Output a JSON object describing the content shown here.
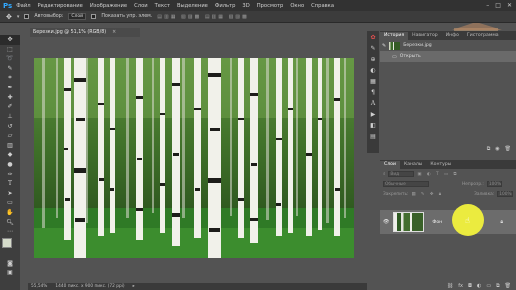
{
  "app": {
    "logo": "Ps"
  },
  "menu": [
    "Файл",
    "Редактирование",
    "Изображение",
    "Слои",
    "Текст",
    "Выделение",
    "Фильтр",
    "3D",
    "Просмотр",
    "Окно",
    "Справка"
  ],
  "window_controls": [
    "–",
    "□",
    "✕"
  ],
  "options_bar": {
    "autoselect_label": "Автовыбор:",
    "autoselect_value": "Слой",
    "show_controls_label": "Показать упр. элем."
  },
  "document": {
    "tab_title": "Березки.jpg @ 51,1% (RGB/8)",
    "close_glyph": "×",
    "zoom": "55,54%",
    "doc_info": "1440 пикс. x 900 пикс. (72 ppi)"
  },
  "history_panel": {
    "tabs": [
      "История",
      "Навигатор",
      "Инфо",
      "Гистограмма"
    ],
    "snapshot_name": "Березки.jpg",
    "steps": [
      "Открыть"
    ]
  },
  "layers_panel": {
    "tabs": [
      "Слои",
      "Каналы",
      "Контуры"
    ],
    "kind_label": "Вид",
    "blend_mode": "Обычные",
    "opacity_label": "Непрозр.:",
    "opacity_value": "100%",
    "lock_label": "Закрепить:",
    "fill_label": "Заливка:",
    "fill_value": "100%",
    "layers": [
      {
        "name": "Фон",
        "visible": true,
        "locked": true
      }
    ]
  },
  "colors": {
    "menubar": "#323232",
    "panel": "#535353",
    "highlight": "#f6f63c",
    "ps_blue": "#31a8ff"
  }
}
